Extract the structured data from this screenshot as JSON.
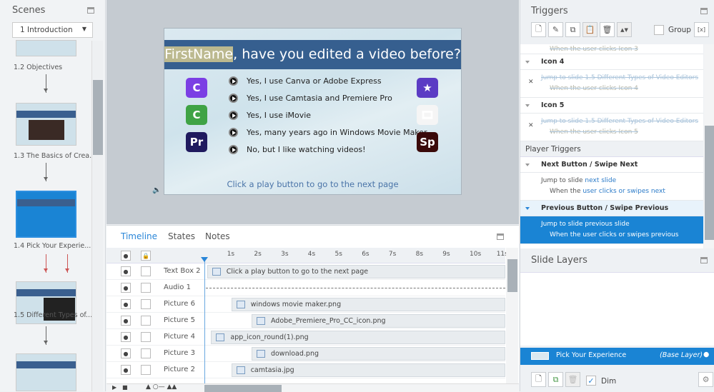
{
  "scenes": {
    "title": "Scenes",
    "selected_scene": "1 Introduction",
    "slides": [
      {
        "label": "1.2 Objectives"
      },
      {
        "label": "1.3 The Basics of Crea..."
      },
      {
        "label": "1.4 Pick Your Experie..."
      },
      {
        "label": "1.5 Different Types of..."
      }
    ]
  },
  "slide": {
    "name_var": "FirstName",
    "title_rest": ", have you edited a video before?",
    "options": [
      "Yes, I use Canva or Adobe Express",
      "Yes, I use Camtasia and Premiere Pro",
      "Yes, I use iMovie",
      "Yes, many years ago in Windows Movie Maker.",
      "No, but I like watching videos!"
    ],
    "left_icons": [
      {
        "name": "canva-icon",
        "glyph": "C",
        "color": "#7b3fe4"
      },
      {
        "name": "camtasia-icon",
        "glyph": "C",
        "color": "#3fa345"
      },
      {
        "name": "premiere-pro-icon",
        "glyph": "Pr",
        "color": "#1f1a5e"
      }
    ],
    "right_icons": [
      {
        "name": "imovie-icon",
        "glyph": "★",
        "color": "#5b3cc4"
      },
      {
        "name": "windows-movie-maker-icon",
        "glyph": "🎞",
        "color": "#f5f5f5"
      },
      {
        "name": "spark-icon",
        "glyph": "Sp",
        "color": "#3a0a0a"
      }
    ],
    "footer": "Click a play button to go to the next page"
  },
  "timeline": {
    "tabs": [
      "Timeline",
      "States",
      "Notes"
    ],
    "active_tab": "Timeline",
    "ticks": [
      "1s",
      "2s",
      "3s",
      "4s",
      "5s",
      "6s",
      "7s",
      "8s",
      "9s",
      "10s",
      "11s"
    ],
    "rows": [
      {
        "label": "Text Box 2",
        "bar": "Click a play button to go to the next page",
        "start_s": 0.1,
        "kind": "text"
      },
      {
        "label": "Audio 1",
        "bar": "",
        "start_s": 0,
        "kind": "audio"
      },
      {
        "label": "Picture 6",
        "bar": "windows movie maker.png",
        "start_s": 1.0,
        "kind": "pic"
      },
      {
        "label": "Picture 5",
        "bar": "Adobe_Premiere_Pro_CC_icon.png",
        "start_s": 1.75,
        "kind": "pic"
      },
      {
        "label": "Picture 4",
        "bar": "app_icon_round(1).png",
        "start_s": 0.25,
        "kind": "pic"
      },
      {
        "label": "Picture 3",
        "bar": "download.png",
        "start_s": 1.75,
        "kind": "pic"
      },
      {
        "label": "Picture 2",
        "bar": "camtasia.jpg",
        "start_s": 1.0,
        "kind": "pic"
      }
    ]
  },
  "triggers": {
    "title": "Triggers",
    "group_label": "Group",
    "items": [
      {
        "type": "tail",
        "when": "When the user clicks Icon 3",
        "state": "dis"
      },
      {
        "type": "hdr",
        "label": "Icon 4"
      },
      {
        "type": "act",
        "action": "Jump to slide 1.5 Different Types of Video Editors",
        "when": "When the user clicks Icon 4",
        "state": "dis"
      },
      {
        "type": "hdr",
        "label": "Icon 5"
      },
      {
        "type": "act",
        "action": "Jump to slide 1.5 Different Types of Video Editors",
        "when": "When the user clicks Icon 5",
        "state": "dis"
      },
      {
        "type": "section",
        "label": "Player Triggers"
      },
      {
        "type": "hdr",
        "label": "Next Button / Swipe Next"
      },
      {
        "type": "act",
        "action_pre": "Jump to slide ",
        "action_link": "next slide",
        "when_pre": "When the ",
        "when_link": "user clicks or swipes next",
        "state": "en"
      },
      {
        "type": "hdr",
        "label": "Previous Button / Swipe Previous",
        "active": true
      },
      {
        "type": "act",
        "action_pre": "Jump to slide ",
        "action_link": "previous slide",
        "when_pre": "When the ",
        "when_link": "user clicks or swipes previous",
        "state": "sel"
      }
    ]
  },
  "layers": {
    "title": "Slide Layers",
    "base_name": "Pick Your Experience",
    "base_tag": "(Base Layer)",
    "dim_label": "Dim",
    "dim_checked": true
  }
}
